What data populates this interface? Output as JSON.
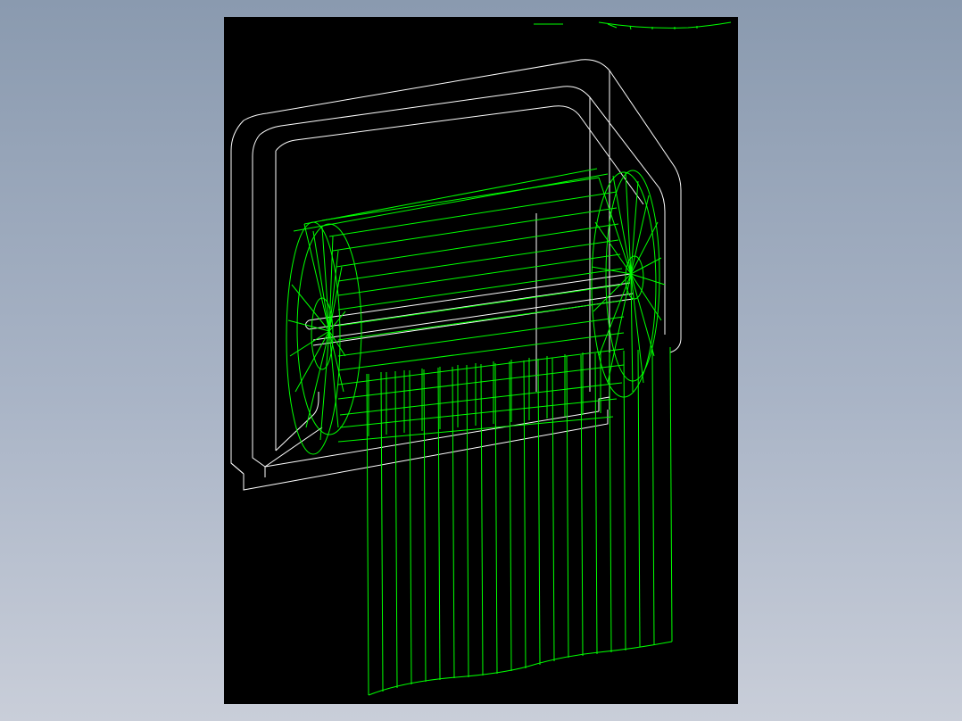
{
  "viewport": {
    "background_color": "#000000",
    "window_background_top": "#8a9aaf",
    "window_background_bottom": "#c9ced9"
  },
  "model": {
    "housing_line_color": "#ffffff",
    "roll_line_color": "#00ff00",
    "render_mode": "wireframe",
    "housing_icon": "dispenser-housing-icon",
    "roll_icon": "paper-roll-icon",
    "sheet_icon": "paper-sheet-icon"
  }
}
